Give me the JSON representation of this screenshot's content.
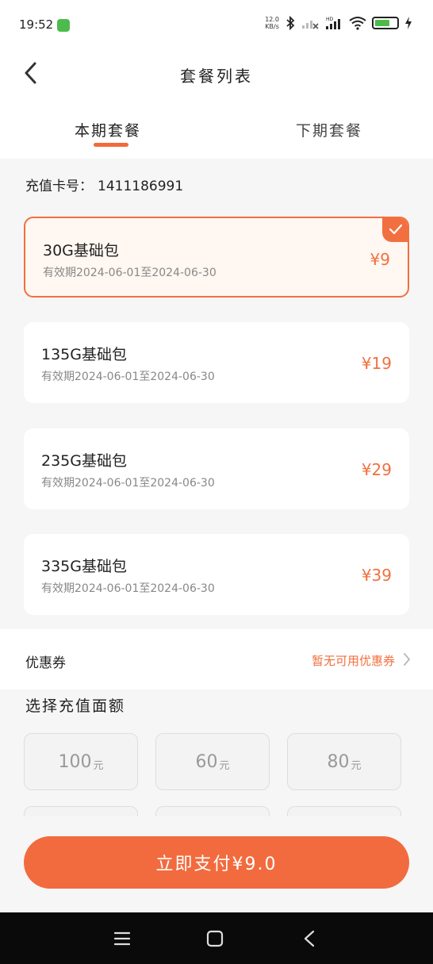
{
  "status_bar": {
    "time": "19:52",
    "net_speed_value": "12.0",
    "net_speed_unit": "KB/s",
    "battery_icon": "battery-icon",
    "wifi_icon": "wifi-icon",
    "bluetooth_icon": "bluetooth-icon"
  },
  "header": {
    "title": "套餐列表",
    "back_icon": "chevron-left-icon"
  },
  "tabs": [
    {
      "label": "本期套餐",
      "active": true
    },
    {
      "label": "下期套餐",
      "active": false
    }
  ],
  "card": {
    "label": "充值卡号：",
    "number": "1411186991"
  },
  "packages": [
    {
      "name": "30G基础包",
      "validity": "有效期2024-06-01至2024-06-30",
      "price": "¥9",
      "selected": true
    },
    {
      "name": "135G基础包",
      "validity": "有效期2024-06-01至2024-06-30",
      "price": "¥19",
      "selected": false
    },
    {
      "name": "235G基础包",
      "validity": "有效期2024-06-01至2024-06-30",
      "price": "¥29",
      "selected": false
    },
    {
      "name": "335G基础包",
      "validity": "有效期2024-06-01至2024-06-30",
      "price": "¥39",
      "selected": false
    }
  ],
  "coupon": {
    "label": "优惠券",
    "value": "暂无可用优惠券"
  },
  "amount": {
    "title": "选择充值面额",
    "options": [
      {
        "value": "100",
        "unit": "元"
      },
      {
        "value": "60",
        "unit": "元"
      },
      {
        "value": "80",
        "unit": "元"
      }
    ]
  },
  "pay_button": {
    "label": "立即支付¥9.0"
  },
  "colors": {
    "accent": "#f26b3e",
    "selected_bg": "#fff7f1",
    "page_bg": "#f6f6f6"
  }
}
